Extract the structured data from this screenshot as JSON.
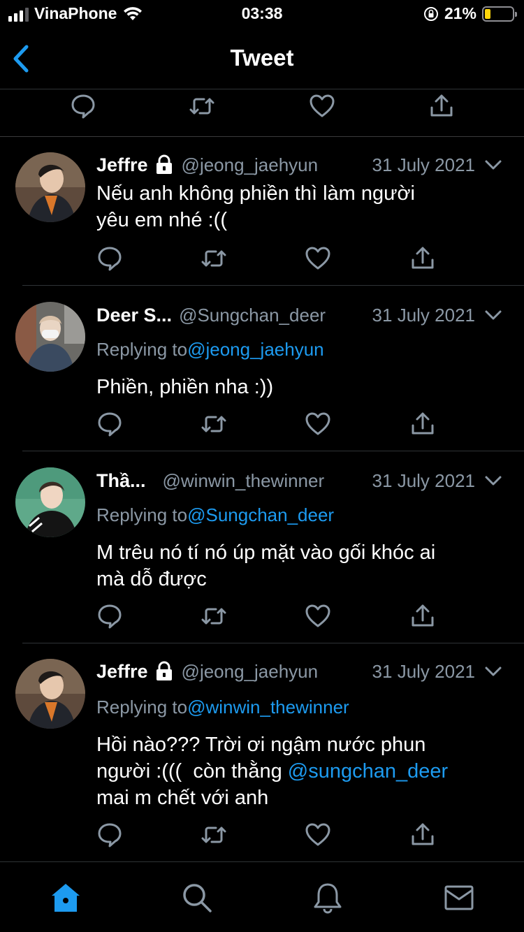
{
  "status_bar": {
    "carrier": "VinaPhone",
    "time": "03:38",
    "battery_percent_label": "21%",
    "battery_level": 0.21,
    "battery_color": "#ffd60a"
  },
  "header": {
    "title": "Tweet",
    "back_icon": "chevron-left-icon"
  },
  "colors": {
    "background": "#000000",
    "accent": "#1d9bf0",
    "muted_text": "#8b98a5",
    "divider": "#2f3336"
  },
  "replies": [
    {
      "name": "Jeffre",
      "protected": true,
      "handle": "@jeong_jaehyun",
      "date": "31 July 2021",
      "replying_label": "",
      "replying_to": "",
      "text_lines": [
        "Nếu anh không phiền thì làm người",
        "yêu em nhé :(("
      ]
    },
    {
      "name": "Deer S...",
      "protected": false,
      "handle": "@Sungchan_deer",
      "date": "31 July 2021",
      "replying_label": "Replying to",
      "replying_to": "@jeong_jaehyun",
      "text_lines": [
        "Phiền, phiền nha :))"
      ]
    },
    {
      "name": "Thầ...",
      "protected": false,
      "handle": "@winwin_thewinner",
      "date": "31 July 2021",
      "replying_label": "Replying to",
      "replying_to": "@Sungchan_deer",
      "text_lines": [
        "M trêu nó tí nó úp mặt vào gối khóc ai",
        "mà dỗ được"
      ]
    },
    {
      "name": "Jeffre",
      "protected": true,
      "handle": "@jeong_jaehyun",
      "date": "31 July 2021",
      "replying_label": "Replying to",
      "replying_to": "@winwin_thewinner",
      "text_line_1": "Hồi nào??? Trời ơi ngậm nước phun",
      "text_line_2_prefix": "người :(((  còn thằng ",
      "text_line_2_mention": "@sungchan_deer",
      "text_line_3": "mai m chết với anh"
    }
  ],
  "tabbar": {
    "tabs": [
      "home-icon",
      "search-icon",
      "notifications-bell-icon",
      "messages-envelope-icon"
    ],
    "active_tab": "home-icon"
  }
}
